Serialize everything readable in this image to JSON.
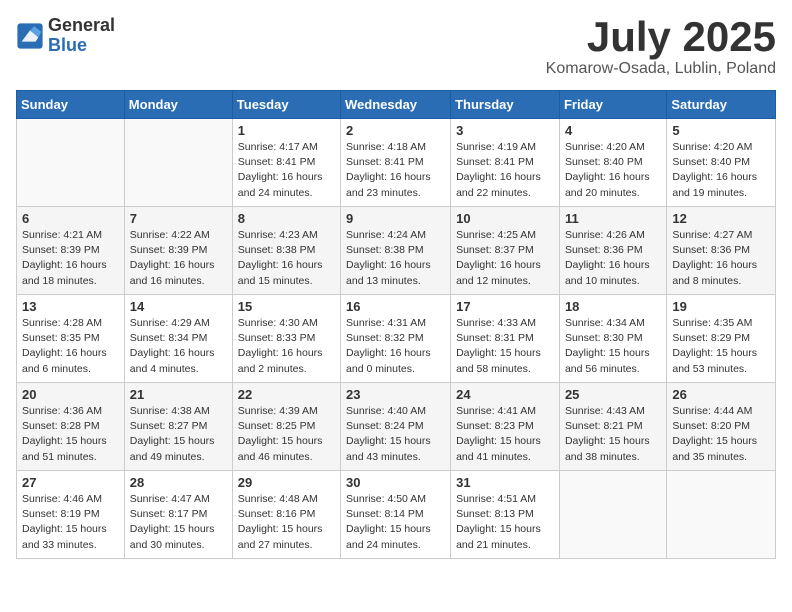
{
  "header": {
    "logo_general": "General",
    "logo_blue": "Blue",
    "title": "July 2025",
    "location": "Komarow-Osada, Lublin, Poland"
  },
  "calendar": {
    "days_of_week": [
      "Sunday",
      "Monday",
      "Tuesday",
      "Wednesday",
      "Thursday",
      "Friday",
      "Saturday"
    ],
    "weeks": [
      [
        {
          "day": "",
          "info": ""
        },
        {
          "day": "",
          "info": ""
        },
        {
          "day": "1",
          "info": "Sunrise: 4:17 AM\nSunset: 8:41 PM\nDaylight: 16 hours\nand 24 minutes."
        },
        {
          "day": "2",
          "info": "Sunrise: 4:18 AM\nSunset: 8:41 PM\nDaylight: 16 hours\nand 23 minutes."
        },
        {
          "day": "3",
          "info": "Sunrise: 4:19 AM\nSunset: 8:41 PM\nDaylight: 16 hours\nand 22 minutes."
        },
        {
          "day": "4",
          "info": "Sunrise: 4:20 AM\nSunset: 8:40 PM\nDaylight: 16 hours\nand 20 minutes."
        },
        {
          "day": "5",
          "info": "Sunrise: 4:20 AM\nSunset: 8:40 PM\nDaylight: 16 hours\nand 19 minutes."
        }
      ],
      [
        {
          "day": "6",
          "info": "Sunrise: 4:21 AM\nSunset: 8:39 PM\nDaylight: 16 hours\nand 18 minutes."
        },
        {
          "day": "7",
          "info": "Sunrise: 4:22 AM\nSunset: 8:39 PM\nDaylight: 16 hours\nand 16 minutes."
        },
        {
          "day": "8",
          "info": "Sunrise: 4:23 AM\nSunset: 8:38 PM\nDaylight: 16 hours\nand 15 minutes."
        },
        {
          "day": "9",
          "info": "Sunrise: 4:24 AM\nSunset: 8:38 PM\nDaylight: 16 hours\nand 13 minutes."
        },
        {
          "day": "10",
          "info": "Sunrise: 4:25 AM\nSunset: 8:37 PM\nDaylight: 16 hours\nand 12 minutes."
        },
        {
          "day": "11",
          "info": "Sunrise: 4:26 AM\nSunset: 8:36 PM\nDaylight: 16 hours\nand 10 minutes."
        },
        {
          "day": "12",
          "info": "Sunrise: 4:27 AM\nSunset: 8:36 PM\nDaylight: 16 hours\nand 8 minutes."
        }
      ],
      [
        {
          "day": "13",
          "info": "Sunrise: 4:28 AM\nSunset: 8:35 PM\nDaylight: 16 hours\nand 6 minutes."
        },
        {
          "day": "14",
          "info": "Sunrise: 4:29 AM\nSunset: 8:34 PM\nDaylight: 16 hours\nand 4 minutes."
        },
        {
          "day": "15",
          "info": "Sunrise: 4:30 AM\nSunset: 8:33 PM\nDaylight: 16 hours\nand 2 minutes."
        },
        {
          "day": "16",
          "info": "Sunrise: 4:31 AM\nSunset: 8:32 PM\nDaylight: 16 hours\nand 0 minutes."
        },
        {
          "day": "17",
          "info": "Sunrise: 4:33 AM\nSunset: 8:31 PM\nDaylight: 15 hours\nand 58 minutes."
        },
        {
          "day": "18",
          "info": "Sunrise: 4:34 AM\nSunset: 8:30 PM\nDaylight: 15 hours\nand 56 minutes."
        },
        {
          "day": "19",
          "info": "Sunrise: 4:35 AM\nSunset: 8:29 PM\nDaylight: 15 hours\nand 53 minutes."
        }
      ],
      [
        {
          "day": "20",
          "info": "Sunrise: 4:36 AM\nSunset: 8:28 PM\nDaylight: 15 hours\nand 51 minutes."
        },
        {
          "day": "21",
          "info": "Sunrise: 4:38 AM\nSunset: 8:27 PM\nDaylight: 15 hours\nand 49 minutes."
        },
        {
          "day": "22",
          "info": "Sunrise: 4:39 AM\nSunset: 8:25 PM\nDaylight: 15 hours\nand 46 minutes."
        },
        {
          "day": "23",
          "info": "Sunrise: 4:40 AM\nSunset: 8:24 PM\nDaylight: 15 hours\nand 43 minutes."
        },
        {
          "day": "24",
          "info": "Sunrise: 4:41 AM\nSunset: 8:23 PM\nDaylight: 15 hours\nand 41 minutes."
        },
        {
          "day": "25",
          "info": "Sunrise: 4:43 AM\nSunset: 8:21 PM\nDaylight: 15 hours\nand 38 minutes."
        },
        {
          "day": "26",
          "info": "Sunrise: 4:44 AM\nSunset: 8:20 PM\nDaylight: 15 hours\nand 35 minutes."
        }
      ],
      [
        {
          "day": "27",
          "info": "Sunrise: 4:46 AM\nSunset: 8:19 PM\nDaylight: 15 hours\nand 33 minutes."
        },
        {
          "day": "28",
          "info": "Sunrise: 4:47 AM\nSunset: 8:17 PM\nDaylight: 15 hours\nand 30 minutes."
        },
        {
          "day": "29",
          "info": "Sunrise: 4:48 AM\nSunset: 8:16 PM\nDaylight: 15 hours\nand 27 minutes."
        },
        {
          "day": "30",
          "info": "Sunrise: 4:50 AM\nSunset: 8:14 PM\nDaylight: 15 hours\nand 24 minutes."
        },
        {
          "day": "31",
          "info": "Sunrise: 4:51 AM\nSunset: 8:13 PM\nDaylight: 15 hours\nand 21 minutes."
        },
        {
          "day": "",
          "info": ""
        },
        {
          "day": "",
          "info": ""
        }
      ]
    ]
  }
}
